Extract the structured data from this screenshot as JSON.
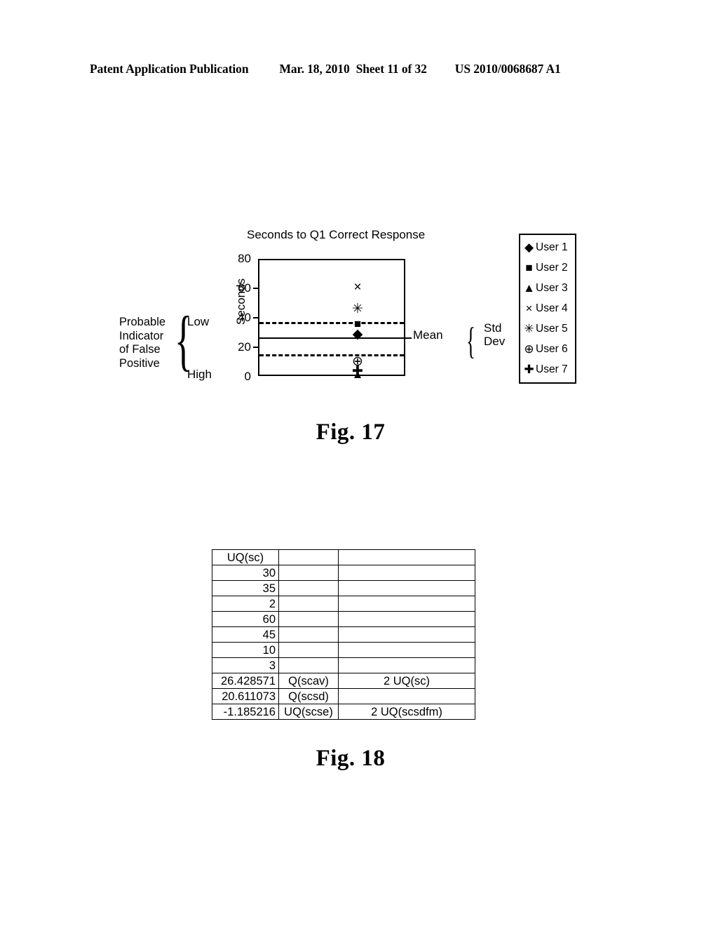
{
  "header": {
    "publication": "Patent Application Publication",
    "date": "Mar. 18, 2010",
    "sheet": "Sheet 11 of 32",
    "patent_number": "US 2010/0068687 A1"
  },
  "fig17": {
    "caption": "Fig. 17",
    "left_bracket": {
      "text_line1": "Probable",
      "text_line2": "Indicator",
      "text_line3": "of False",
      "text_line4": "Positive",
      "brace": "{",
      "top_label": "Low",
      "bottom_label": "High"
    },
    "axis_label": "Seconds",
    "mean_label": "Mean",
    "std_dev": {
      "brace": "}",
      "line1": "Std",
      "line2": "Dev"
    },
    "legend": {
      "entries": [
        {
          "marker": "diamond-marker",
          "glyph": "◆",
          "label": "User 1"
        },
        {
          "marker": "square-marker",
          "glyph": "■",
          "label": "User 2"
        },
        {
          "marker": "triangle-marker",
          "glyph": "▲",
          "label": "User 3"
        },
        {
          "marker": "cross-x-marker",
          "glyph": "×",
          "label": "User 4"
        },
        {
          "marker": "asterisk-marker",
          "glyph": "✳",
          "label": "User 5"
        },
        {
          "marker": "circled-plus-marker",
          "glyph": "⊕",
          "label": "User 6"
        },
        {
          "marker": "plus-marker",
          "glyph": "✚",
          "label": "User 7"
        }
      ]
    }
  },
  "chart_data": {
    "type": "scatter",
    "title": "Seconds to Q1 Correct Response",
    "xlabel": "",
    "ylabel": "Seconds",
    "ylim": [
      0,
      80
    ],
    "yticks": [
      0,
      20,
      40,
      60,
      80
    ],
    "grid": false,
    "legend_position": "right-outside",
    "x_single_category": true,
    "points": [
      {
        "series": "User 4",
        "glyph": "×",
        "value": 60,
        "marker": "cross-x-marker"
      },
      {
        "series": "User 5",
        "glyph": "✳",
        "value": 45,
        "marker": "asterisk-marker"
      },
      {
        "series": "User 2",
        "glyph": "■",
        "value": 35,
        "marker": "square-marker"
      },
      {
        "series": "User 1",
        "glyph": "◆",
        "value": 30,
        "marker": "diamond-marker"
      },
      {
        "series": "User 6",
        "glyph": "⊕",
        "value": 10,
        "marker": "circled-plus-marker"
      },
      {
        "series": "User 7",
        "glyph": "✚",
        "value": 3,
        "marker": "plus-marker"
      },
      {
        "series": "User 3",
        "glyph": "▲",
        "value": 2,
        "marker": "triangle-marker"
      }
    ],
    "reference_lines": [
      {
        "name": "upper-std-dev",
        "value": 37,
        "style": "dashed",
        "label": "Std Dev"
      },
      {
        "name": "mean",
        "value": 26.428571,
        "style": "solid",
        "label": "Mean"
      },
      {
        "name": "lower-std-dev",
        "value": 15,
        "style": "dashed",
        "label": "Std Dev"
      }
    ]
  },
  "fig18": {
    "caption": "Fig. 18",
    "table": {
      "rows": [
        {
          "a": "UQ(sc)",
          "b": "",
          "c": "",
          "a_align": "center"
        },
        {
          "a": "30",
          "b": "",
          "c": ""
        },
        {
          "a": "35",
          "b": "",
          "c": ""
        },
        {
          "a": "2",
          "b": "",
          "c": ""
        },
        {
          "a": "60",
          "b": "",
          "c": ""
        },
        {
          "a": "45",
          "b": "",
          "c": ""
        },
        {
          "a": "10",
          "b": "",
          "c": ""
        },
        {
          "a": "3",
          "b": "",
          "c": ""
        },
        {
          "a": "26.428571",
          "b": "Q(scav)",
          "c": "2 UQ(sc)"
        },
        {
          "a": "20.611073",
          "b": "Q(scsd)",
          "c": ""
        },
        {
          "a": "-1.185216",
          "b": "UQ(scse)",
          "c": "2 UQ(scsdfm)"
        }
      ]
    }
  }
}
